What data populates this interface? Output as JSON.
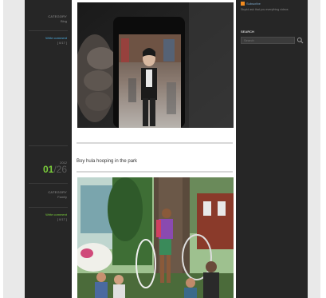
{
  "sidebar": {
    "post1": {
      "category_label": "CATEGORY",
      "category_value": "Blog",
      "comment_label": "Write comment",
      "comment_count": "[ 0/17 ]"
    },
    "post2": {
      "year": "2012",
      "date_day": "01",
      "date_total": "/26",
      "category_label": "CATEGORY",
      "category_value": "Family",
      "comment_label": "Write comment",
      "comment_count": "[ 0/17 ]"
    }
  },
  "main": {
    "post2_title": "Boy hula hooping in the park"
  },
  "right_sidebar": {
    "rss_label": "Subscribe",
    "rss_desc": "Stupid ask that you everything videos",
    "search_heading": "SEARCH",
    "search_placeholder": "Search"
  },
  "colors": {
    "accent_green": "#7acc3b",
    "link_blue": "#4fb3e8",
    "column_dark": "#262626"
  }
}
